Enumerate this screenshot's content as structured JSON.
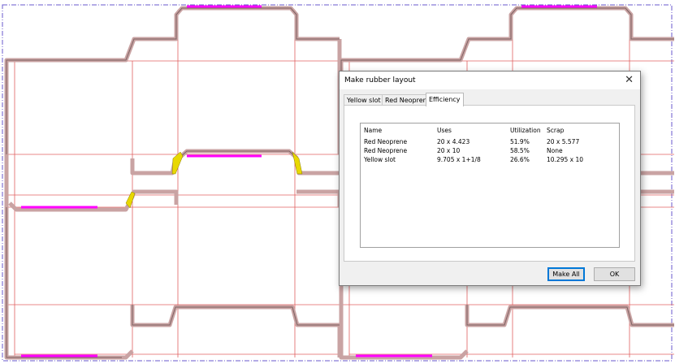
{
  "dialog": {
    "title": "Make rubber layout",
    "close_glyph": "✕",
    "tabs": [
      {
        "label": "Yellow slot",
        "active": false
      },
      {
        "label": "Red Neoprene",
        "active": false
      },
      {
        "label": "Efficiency",
        "active": true
      }
    ],
    "table": {
      "headers": [
        "Name",
        "Uses",
        "Utilization",
        "Scrap"
      ],
      "rows": [
        [
          "Red Neoprene",
          "20 x 4.423",
          "51.9%",
          "20 x 5.577"
        ],
        [
          "Red Neoprene",
          "20 x 10",
          "58.5%",
          "None"
        ],
        [
          "Yellow slot",
          "9.705 x 1+1/8",
          "26.6%",
          "10.295 x 10"
        ]
      ]
    },
    "buttons": {
      "make_all": "Make All",
      "ok": "OK"
    }
  },
  "colors": {
    "rubber": "#c9a3a3",
    "rubber_edge": "#7d6262",
    "cut_line": "#e06060",
    "crease_line": "#d68a8a",
    "magenta_strip": "#ff00ff",
    "yellow_slot": "#e8d800",
    "border_dashed": "#6a5acd",
    "accent": "#0078d7"
  }
}
